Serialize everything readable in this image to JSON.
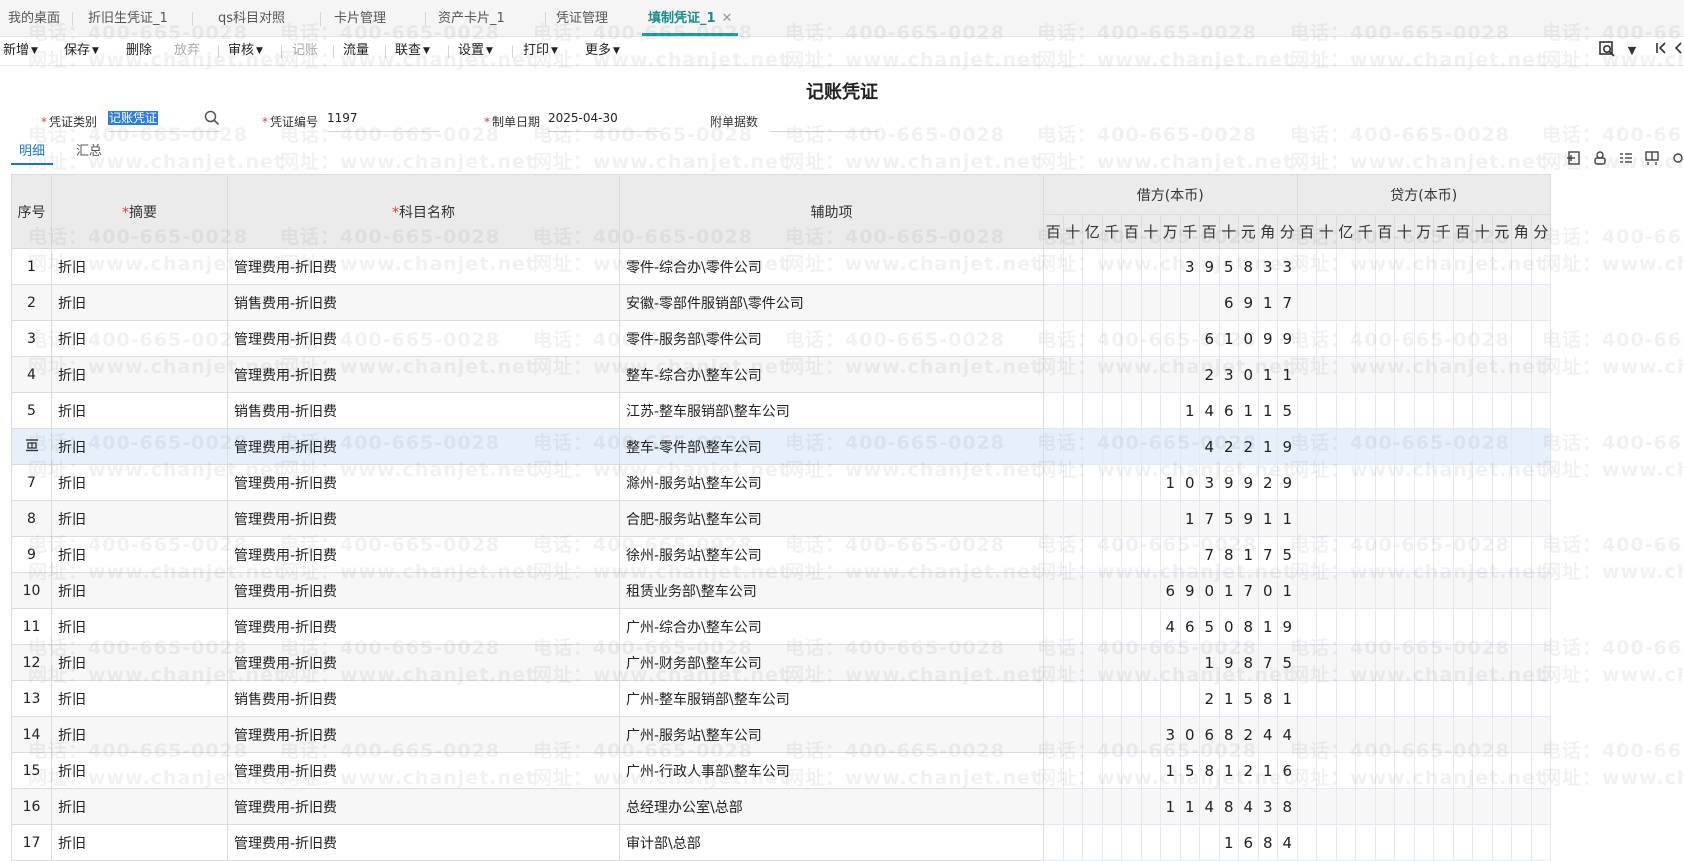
{
  "tabs": [
    {
      "label": "我的桌面",
      "active": false
    },
    {
      "label": "折旧生凭证_1",
      "active": false
    },
    {
      "label": "qs科目对照",
      "active": false
    },
    {
      "label": "卡片管理",
      "active": false
    },
    {
      "label": "资产卡片_1",
      "active": false
    },
    {
      "label": "凭证管理",
      "active": false
    },
    {
      "label": "填制凭证_1",
      "active": true
    }
  ],
  "toolbar": {
    "add": "新增",
    "save": "保存",
    "delete": "删除",
    "discard": "放弃",
    "audit": "审核",
    "post": "记账",
    "cashflow": "流量",
    "query": "联查",
    "settings": "设置",
    "print": "打印",
    "more": "更多"
  },
  "title": "记账凭证",
  "header": {
    "voucher_type_label": "凭证类别",
    "voucher_type_value": "记账凭证",
    "voucher_no_label": "凭证编号",
    "voucher_no_value": "1197",
    "date_label": "制单日期",
    "date_value": "2025-04-30",
    "attachments_label": "附单据数",
    "attachments_value": ""
  },
  "detail_tabs": [
    "明细",
    "汇总"
  ],
  "table": {
    "col_seq": "序号",
    "col_summary": "摘要",
    "col_account": "科目名称",
    "col_aux": "辅助项",
    "col_debit": "借方(本币)",
    "col_credit": "贷方(本币)",
    "digit_units": [
      "百",
      "十",
      "亿",
      "千",
      "百",
      "十",
      "万",
      "千",
      "百",
      "十",
      "元",
      "角",
      "分"
    ],
    "rows": [
      {
        "seq": "1",
        "summary": "折旧",
        "account": "管理费用-折旧费",
        "aux": "零件-综合办\\零件公司",
        "debit": "395833"
      },
      {
        "seq": "2",
        "summary": "折旧",
        "account": "销售费用-折旧费",
        "aux": "安徽-零部件服销部\\零件公司",
        "debit": "6917"
      },
      {
        "seq": "3",
        "summary": "折旧",
        "account": "管理费用-折旧费",
        "aux": "零件-服务部\\零件公司",
        "debit": "61099"
      },
      {
        "seq": "4",
        "summary": "折旧",
        "account": "管理费用-折旧费",
        "aux": "整车-综合办\\整车公司",
        "debit": "23011"
      },
      {
        "seq": "5",
        "summary": "折旧",
        "account": "销售费用-折旧费",
        "aux": "江苏-整车服销部\\整车公司",
        "debit": "146115"
      },
      {
        "seq": "",
        "summary": "折旧",
        "account": "管理费用-折旧费",
        "aux": "整车-零件部\\整车公司",
        "debit": "42219",
        "highlight": true
      },
      {
        "seq": "7",
        "summary": "折旧",
        "account": "管理费用-折旧费",
        "aux": "滁州-服务站\\整车公司",
        "debit": "1039929"
      },
      {
        "seq": "8",
        "summary": "折旧",
        "account": "管理费用-折旧费",
        "aux": "合肥-服务站\\整车公司",
        "debit": "175911"
      },
      {
        "seq": "9",
        "summary": "折旧",
        "account": "管理费用-折旧费",
        "aux": "徐州-服务站\\整车公司",
        "debit": "78175"
      },
      {
        "seq": "10",
        "summary": "折旧",
        "account": "管理费用-折旧费",
        "aux": "租赁业务部\\整车公司",
        "debit": "6901701"
      },
      {
        "seq": "11",
        "summary": "折旧",
        "account": "管理费用-折旧费",
        "aux": "广州-综合办\\整车公司",
        "debit": "4650819"
      },
      {
        "seq": "12",
        "summary": "折旧",
        "account": "管理费用-折旧费",
        "aux": "广州-财务部\\整车公司",
        "debit": "19875"
      },
      {
        "seq": "13",
        "summary": "折旧",
        "account": "销售费用-折旧费",
        "aux": "广州-整车服销部\\整车公司",
        "debit": "21581"
      },
      {
        "seq": "14",
        "summary": "折旧",
        "account": "管理费用-折旧费",
        "aux": "广州-服务站\\整车公司",
        "debit": "3068244"
      },
      {
        "seq": "15",
        "summary": "折旧",
        "account": "管理费用-折旧费",
        "aux": "广州-行政人事部\\整车公司",
        "debit": "1581216"
      },
      {
        "seq": "16",
        "summary": "折旧",
        "account": "管理费用-折旧费",
        "aux": "总经理办公室\\总部",
        "debit": "1148438"
      },
      {
        "seq": "17",
        "summary": "折旧",
        "account": "管理费用-折旧费",
        "aux": "审计部\\总部",
        "debit": "1684"
      }
    ]
  },
  "watermark": {
    "phone": "电话：400-665-0028",
    "site": "网址：www.chanjet.net"
  },
  "icons": {
    "row_insert": "insert-row-icon",
    "tab_close": "close-icon"
  }
}
